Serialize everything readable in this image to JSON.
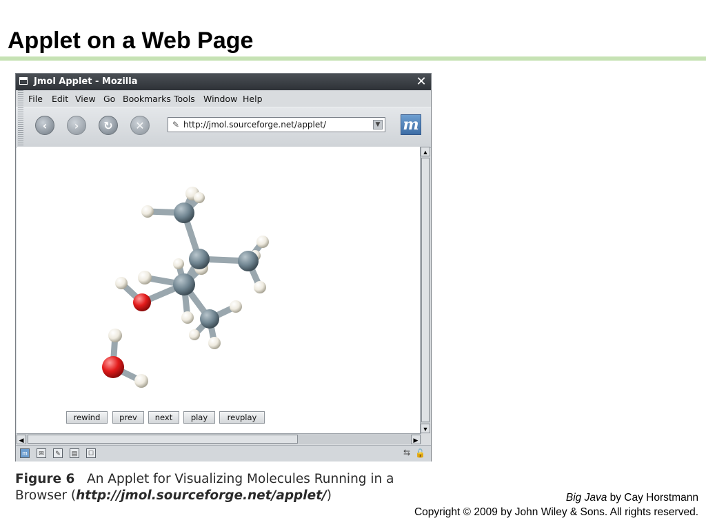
{
  "slide": {
    "title": "Applet on a Web Page",
    "accent_rule_color": "#c6e2b4"
  },
  "browser": {
    "window_title": "Jmol Applet - Mozilla",
    "close_icon": "close-icon",
    "menu": [
      "File",
      "Edit",
      "View",
      "Go",
      "Bookmarks",
      "Tools",
      "Window",
      "Help"
    ],
    "nav_buttons": [
      "back-icon",
      "forward-icon",
      "reload-icon",
      "stop-icon"
    ],
    "url": "http://jmol.sourceforge.net/applet/",
    "status_icons": [
      "mozilla-icon",
      "mail-icon",
      "composer-icon",
      "addressbook-icon",
      "irc-icon"
    ]
  },
  "applet": {
    "buttons": [
      "rewind",
      "prev",
      "next",
      "play",
      "revplay"
    ],
    "atom_colors": {
      "carbon": "#6f8490",
      "hydrogen": "#eeeadf",
      "oxygen": "#e21b1b"
    }
  },
  "caption": {
    "figure_label": "Figure 6",
    "text_line1": "An Applet for Visualizing Molecules Running in a",
    "text_line2_prefix": "Browser (",
    "url": "http://jmol.sourceforge.net/applet/",
    "text_line2_suffix": ")"
  },
  "credit": {
    "book": "Big Java",
    "by": " by Cay Horstmann",
    "copyright": "Copyright © 2009 by John Wiley & Sons.  All rights reserved."
  }
}
